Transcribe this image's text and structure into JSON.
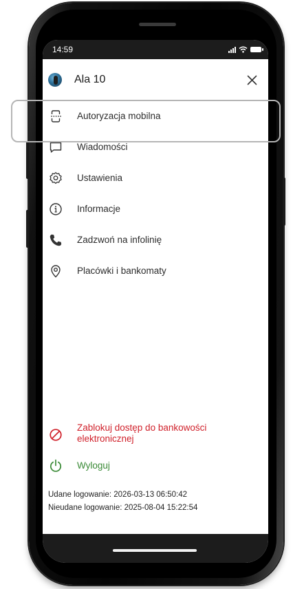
{
  "status_bar": {
    "time": "14:59"
  },
  "header": {
    "user_name": "Ala 10",
    "close_icon": "close-icon"
  },
  "menu": [
    {
      "label": "Autoryzacja mobilna",
      "icon": "mobile-authorization-icon"
    },
    {
      "label": "Wiadomości",
      "icon": "message-icon"
    },
    {
      "label": "Ustawienia",
      "icon": "gear-icon"
    },
    {
      "label": "Informacje",
      "icon": "info-icon"
    },
    {
      "label": "Zadzwoń na infolinię",
      "icon": "phone-icon"
    },
    {
      "label": "Placówki i bankomaty",
      "icon": "location-pin-icon"
    }
  ],
  "lock_access": {
    "label": "Zablokuj dostęp do bankowości elektronicznej",
    "icon": "block-icon",
    "color": "#d0202a"
  },
  "logout": {
    "label": "Wyloguj",
    "icon": "power-icon",
    "color": "#3a8a36"
  },
  "login_info": {
    "success": "Udane logowanie: 2026-03-13 06:50:42",
    "failed": "Nieudane logowanie: 2025-08-04 15:22:54"
  }
}
